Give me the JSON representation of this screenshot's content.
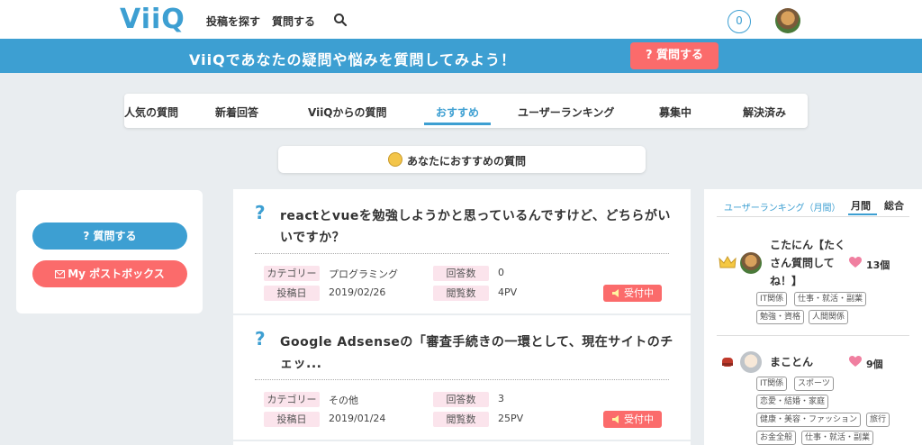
{
  "header": {
    "logo": "ViiQ",
    "nav": [
      "投稿を探す",
      "質問する"
    ],
    "notification_count": "0",
    "colors": {
      "primary": "#3d9fd2",
      "accent": "#fb6b6b"
    }
  },
  "banner": {
    "text": "ViiQであなたの疑問や悩みを質問してみよう！",
    "button": "? 質問する"
  },
  "tabs": [
    "人気の質問",
    "新着回答",
    "ViiQからの質問",
    "おすすめ",
    "ユーザーランキング",
    "募集中",
    "解決済み"
  ],
  "active_tab": "おすすめ",
  "recommend_header": "あなたにおすすめの質問",
  "sidebar": {
    "ask_button": "? 質問する",
    "postbox_button": "My ポストボックス"
  },
  "questions": [
    {
      "title": "reactとvueを勉強しようかと思っているんですけど、どちらがいいですか？",
      "category_label": "カテゴリー",
      "category": "プログラミング",
      "date_label": "投稿日",
      "date": "2019/02/26",
      "answers_label": "回答数",
      "answers": "0",
      "views_label": "閲覧数",
      "views": "4PV",
      "status": "受付中"
    },
    {
      "title": "Google Adsenseの「審査手続きの一環として、現在サイトのチェッ...",
      "category_label": "カテゴリー",
      "category": "その他",
      "date_label": "投稿日",
      "date": "2019/01/24",
      "answers_label": "回答数",
      "answers": "3",
      "views_label": "閲覧数",
      "views": "25PV",
      "status": "受付中"
    }
  ],
  "ranking": {
    "title": "ユーザーランキング（月間）",
    "tabs": [
      "月間",
      "総合"
    ],
    "users": [
      {
        "name_lines": [
          "こたにん【たく",
          "さん質問して",
          "ね！】"
        ],
        "count": "13個",
        "tags": [
          "IT関係",
          "仕事・就活・副業",
          "勉強・資格",
          "人間関係"
        ]
      },
      {
        "name_lines": [
          "まことん"
        ],
        "count": "9個",
        "tags": [
          "IT関係",
          "スポーツ",
          "恋愛・結婚・家庭",
          "健康・美容・ファッション",
          "旅行",
          "お金全般",
          "仕事・就活・副業"
        ]
      }
    ]
  }
}
